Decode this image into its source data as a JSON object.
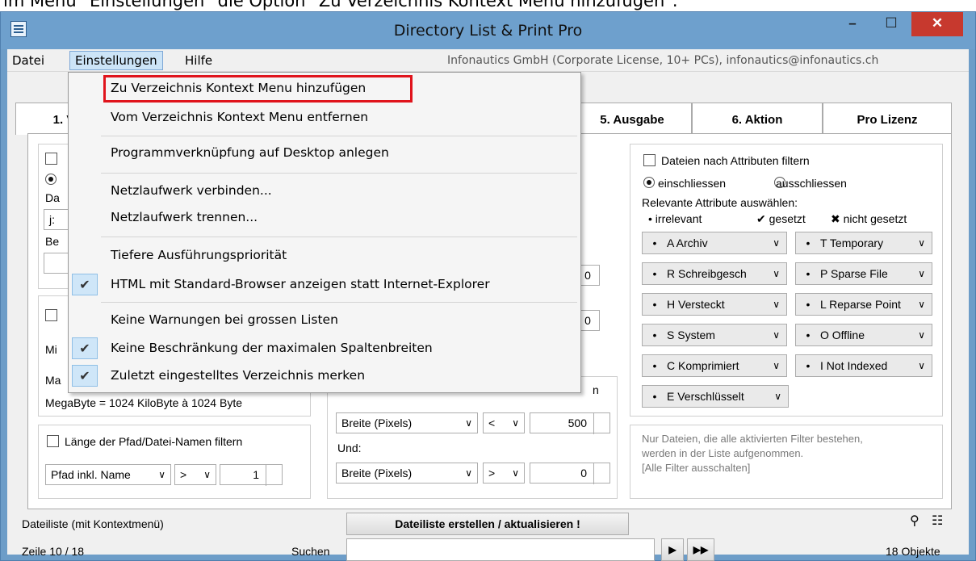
{
  "caption": "im Menü \"Einstellungen\" die Option \"Zu Verzeichnis Kontext Menu hinzufügen\".",
  "window": {
    "title": "Directory List & Print Pro",
    "min_label": "–",
    "max_label": "☐",
    "close_label": "✕"
  },
  "menubar": {
    "items": [
      "Datei",
      "Einstellungen",
      "Hilfe"
    ],
    "license": "Infonautics GmbH (Corporate License, 10+ PCs), infonautics@infonautics.ch"
  },
  "tabs": {
    "t1": "1. V",
    "t5": "5. Ausgabe",
    "t6": "6. Aktion",
    "t7": "Pro Lizenz"
  },
  "dropdown": {
    "items": [
      {
        "label": "Zu Verzeichnis Kontext Menu hinzufügen",
        "checked": false
      },
      {
        "label": "Vom Verzeichnis Kontext Menu entfernen",
        "checked": false
      },
      {
        "label": "Programmverknüpfung auf Desktop anlegen",
        "checked": false
      },
      {
        "label": "Netzlaufwerk verbinden...",
        "checked": false
      },
      {
        "label": "Netzlaufwerk trennen...",
        "checked": false
      },
      {
        "label": "Tiefere Ausführungspriorität",
        "checked": false
      },
      {
        "label": "HTML mit Standard-Browser anzeigen statt Internet-Explorer",
        "checked": true
      },
      {
        "label": "Keine Warnungen bei grossen Listen",
        "checked": false
      },
      {
        "label": "Keine Beschränkung der maximalen Spaltenbreiten",
        "checked": true
      },
      {
        "label": "Zuletzt eingestelltes Verzeichnis merken",
        "checked": true
      }
    ],
    "check_glyph": "✔"
  },
  "left_panel": {
    "partial1": "Da",
    "partial2": "j:",
    "partial3": "Be",
    "partial4": "Mi",
    "partial5": "Ma",
    "megabyte_note": "MegaByte = 1024 KiloByte à 1024 Byte",
    "path_filter_label": "Länge der Pfad/Datei-Namen filtern",
    "path_combo": "Pfad inkl. Name",
    "path_op": ">",
    "path_value": "1"
  },
  "middle_panel": {
    "hidden0": "0",
    "hidden1": "0",
    "partial_n": "n",
    "width_combo1": "Breite (Pixels)",
    "op1": "<",
    "val1": "500",
    "und_label": "Und:",
    "width_combo2": "Breite (Pixels)",
    "op2": ">",
    "val2": "0"
  },
  "attributes": {
    "filter_label": "Dateien nach Attributen filtern",
    "include_label": "einschliessen",
    "exclude_label": "ausschliessen",
    "relevant_label": "Relevante Attribute auswählen:",
    "legend_irrelevant": "• irrelevant",
    "legend_set": "✔ gesetzt",
    "legend_notset": "✖ nicht gesetzt",
    "dot": "•",
    "left": [
      "A Archiv",
      "R Schreibgesch",
      "H Versteckt",
      "S System",
      "C Komprimiert",
      "E Verschlüsselt"
    ],
    "right": [
      "T Temporary",
      "P Sparse File",
      "L Reparse Point",
      "O Offline",
      "I  Not Indexed"
    ],
    "note1": "Nur Dateien, die alle aktivierten Filter bestehen,",
    "note2": "werden in der Liste aufgenommen.",
    "note3": "[Alle Filter ausschalten]"
  },
  "bottom": {
    "list_label": "Dateiliste (mit Kontextmenü)",
    "create_button": "Dateiliste erstellen / aktualisieren !",
    "row_info": "Zeile 10 / 18",
    "search_label": "Suchen",
    "search_value": "",
    "next_label": "▶",
    "last_label": "▶▶",
    "objects": "18 Objekte"
  }
}
